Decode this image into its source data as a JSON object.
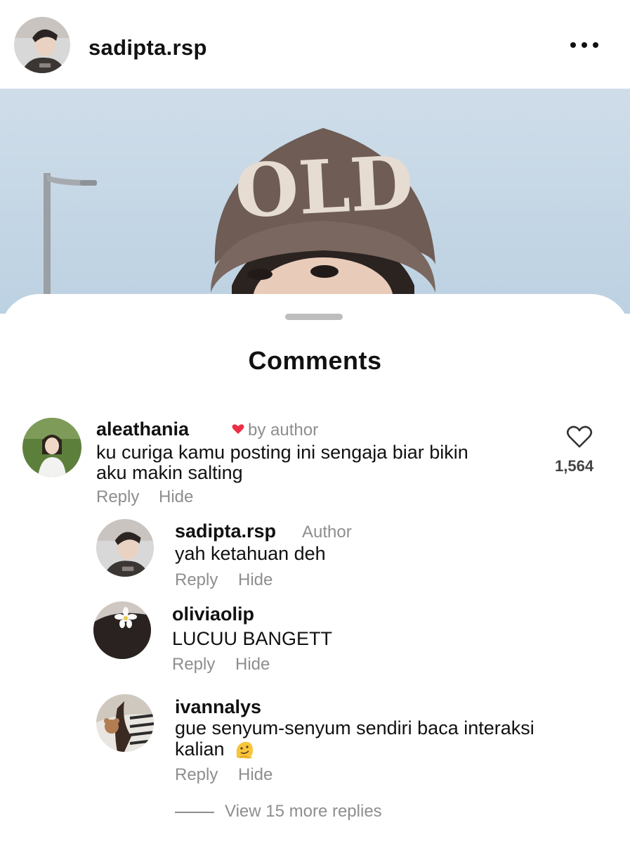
{
  "header": {
    "username": "sadipta.rsp",
    "more_icon": "more-horizontal-icon"
  },
  "sheet": {
    "title": "Comments"
  },
  "comment": {
    "username": "aleathania",
    "liked_by_author": "by author",
    "text_line1": "ku curiga kamu posting ini sengaja biar bikin",
    "text_line2": "aku makin salting",
    "like_count": "1,564",
    "reply_label": "Reply",
    "hide_label": "Hide"
  },
  "replies": [
    {
      "username": "sadipta.rsp",
      "badge": "Author",
      "text_line1": "yah ketahuan deh",
      "reply_label": "Reply",
      "hide_label": "Hide"
    },
    {
      "username": "oliviaolip",
      "text_line1": "LUCUU BANGETT",
      "reply_label": "Reply",
      "hide_label": "Hide"
    },
    {
      "username": "ivannalys",
      "text_line1": "gue senyum-senyum sendiri baca interaksi",
      "text_line2": "kalian",
      "reply_label": "Reply",
      "hide_label": "Hide"
    }
  ],
  "view_more": "View 15 more replies",
  "colors": {
    "heart": "#ed2f45",
    "muted": "#8e8e8e"
  }
}
